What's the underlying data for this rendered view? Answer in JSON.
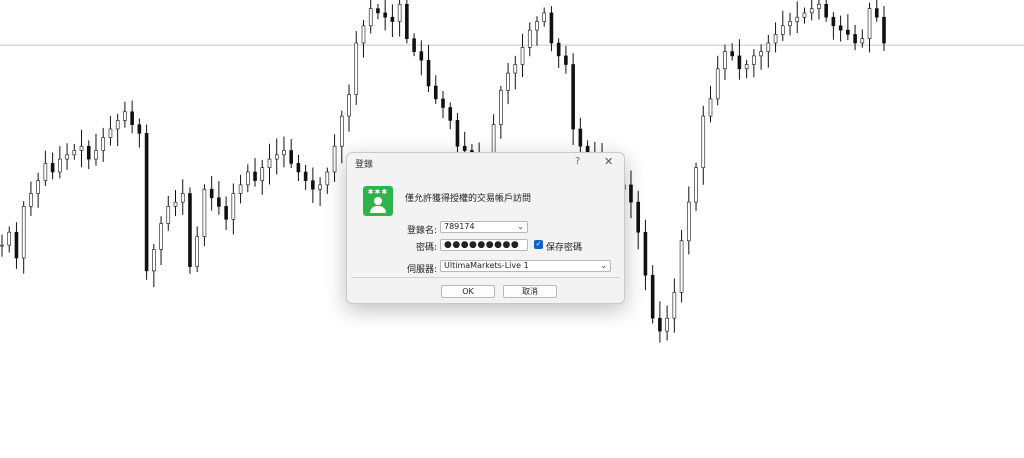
{
  "chart_data": {
    "type": "candlestick",
    "ylim": [
      0,
      100
    ],
    "level_line": 89.5,
    "closes": [
      43,
      46,
      40,
      52,
      55,
      58,
      62,
      60,
      63,
      64,
      65,
      66,
      63,
      65,
      68,
      70,
      72,
      74,
      71,
      69,
      37,
      42,
      48,
      52,
      53,
      55,
      38,
      45,
      56,
      54,
      52,
      49,
      55,
      57,
      60,
      58,
      61,
      63,
      64,
      65,
      62,
      60,
      58,
      56,
      57,
      60,
      66,
      73,
      78,
      90,
      94,
      98,
      97,
      96,
      95,
      99,
      91,
      88,
      86,
      80,
      77,
      75,
      72,
      66,
      65,
      64,
      61,
      62,
      71,
      79,
      83,
      85,
      89,
      93,
      95,
      97,
      90,
      87,
      85,
      70,
      66,
      64,
      63,
      62,
      59,
      56,
      57,
      53,
      46,
      36,
      26,
      23,
      26,
      32,
      44,
      53,
      61,
      73,
      77,
      84,
      88,
      87,
      84,
      85,
      87,
      88,
      90,
      92,
      94,
      95,
      96,
      97,
      98,
      99,
      96,
      94,
      93,
      92,
      90,
      91,
      98,
      96,
      90
    ]
  },
  "dialog": {
    "title": "登錄",
    "help_label": "?",
    "close_label": "✕",
    "message": "僅允許獲得授權的交易帳戶訪問",
    "login_label": "登錄名:",
    "login_value": "789174",
    "password_label": "密碼:",
    "password_value": "●●●●●●●●●",
    "save_password_label": "保存密碼",
    "save_password_checked": true,
    "server_label": "伺服器:",
    "server_value": "UltimaMarkets-Live 1",
    "ok_label": "OK",
    "cancel_label": "取消",
    "icon": "user-account-icon",
    "icon_color": "#2fb44a",
    "accent_color": "#0a64c8"
  }
}
